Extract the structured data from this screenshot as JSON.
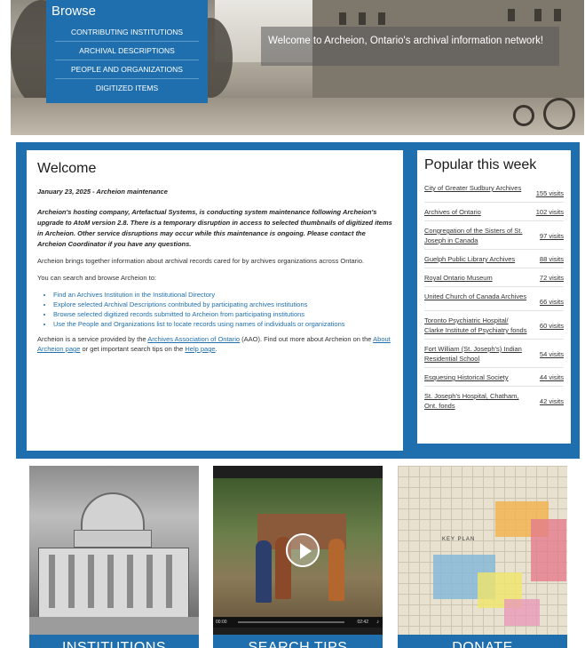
{
  "browse": {
    "title": "Browse",
    "items": [
      {
        "label": "CONTRIBUTING INSTITUTIONS"
      },
      {
        "label": "ARCHIVAL DESCRIPTIONS"
      },
      {
        "label": "PEOPLE AND ORGANIZATIONS"
      },
      {
        "label": "DIGITIZED ITEMS"
      }
    ]
  },
  "hero": {
    "banner": "Welcome to Archeion, Ontario's archival information network!"
  },
  "welcome": {
    "title": "Welcome",
    "date_line": "January 23, 2025 - Archeion maintenance",
    "notice": "Archeion's hosting company, Artefactual Systems, is conducting system maintenance following Archeion's upgrade to AtoM version 2.8. There is a temporary disruption in access to selected thumbnails of digitized items in Archeion. Other service disruptions may occur while this maintenance is ongoing. Please contact the Archeion Coordinator if you have any questions.",
    "intro": "Archeion brings together information about archival records cared for by archives organizations across Ontario.",
    "search_intro": "You can search and browse Archeion to:",
    "links": [
      "Find an Archives Institution in the Institutional Directory",
      "Explore selected Archival Descriptions contributed by participating archives institutions",
      "Browse selected digitized records submitted to Archeion from participating institutions",
      "Use the People and Organizations list to locate records using names of individuals or organizations"
    ],
    "footer_pre": "Archeion is a service provided by the ",
    "footer_link1": "Archives Association of Ontario",
    "footer_mid1": " (AAO). Find out more about Archeion on the ",
    "footer_link2": "About Archeion page",
    "footer_mid2": " or get important search tips on the ",
    "footer_link3": "Help page",
    "footer_end": "."
  },
  "popular": {
    "title": "Popular this week",
    "items": [
      {
        "name": "City of Greater Sudbury Archives",
        "visits": "155 visits"
      },
      {
        "name": "Archives of Ontario",
        "visits": "102 visits"
      },
      {
        "name": "Congregation of the Sisters of St. Joseph in Canada",
        "visits": "97 visits"
      },
      {
        "name": "Guelph Public Library Archives",
        "visits": "88 visits"
      },
      {
        "name": "Royal Ontario Museum",
        "visits": "72 visits"
      },
      {
        "name": "United Church of Canada Archives",
        "visits": "66 visits"
      },
      {
        "name": "Toronto Psychiatric Hospital/ Clarke Institute of Psychiatry fonds",
        "visits": "60 visits"
      },
      {
        "name": "Fort William (St. Joseph's) Indian Residential School",
        "visits": "54 visits"
      },
      {
        "name": "Esquesing Historical Society",
        "visits": "44 visits"
      },
      {
        "name": "St. Joseph's Hospital, Chatham, Ont. fonds",
        "visits": "42 visits"
      }
    ]
  },
  "cards": {
    "institutions": "INSTITUTIONS",
    "search_tips": "SEARCH TIPS",
    "donate": "DONATE",
    "video_time_start": "00:00",
    "video_time_end": "02:42",
    "map_label": "KEY PLAN"
  },
  "colors": {
    "brand_blue": "#1f6fae",
    "link_blue": "#1f6fae"
  }
}
